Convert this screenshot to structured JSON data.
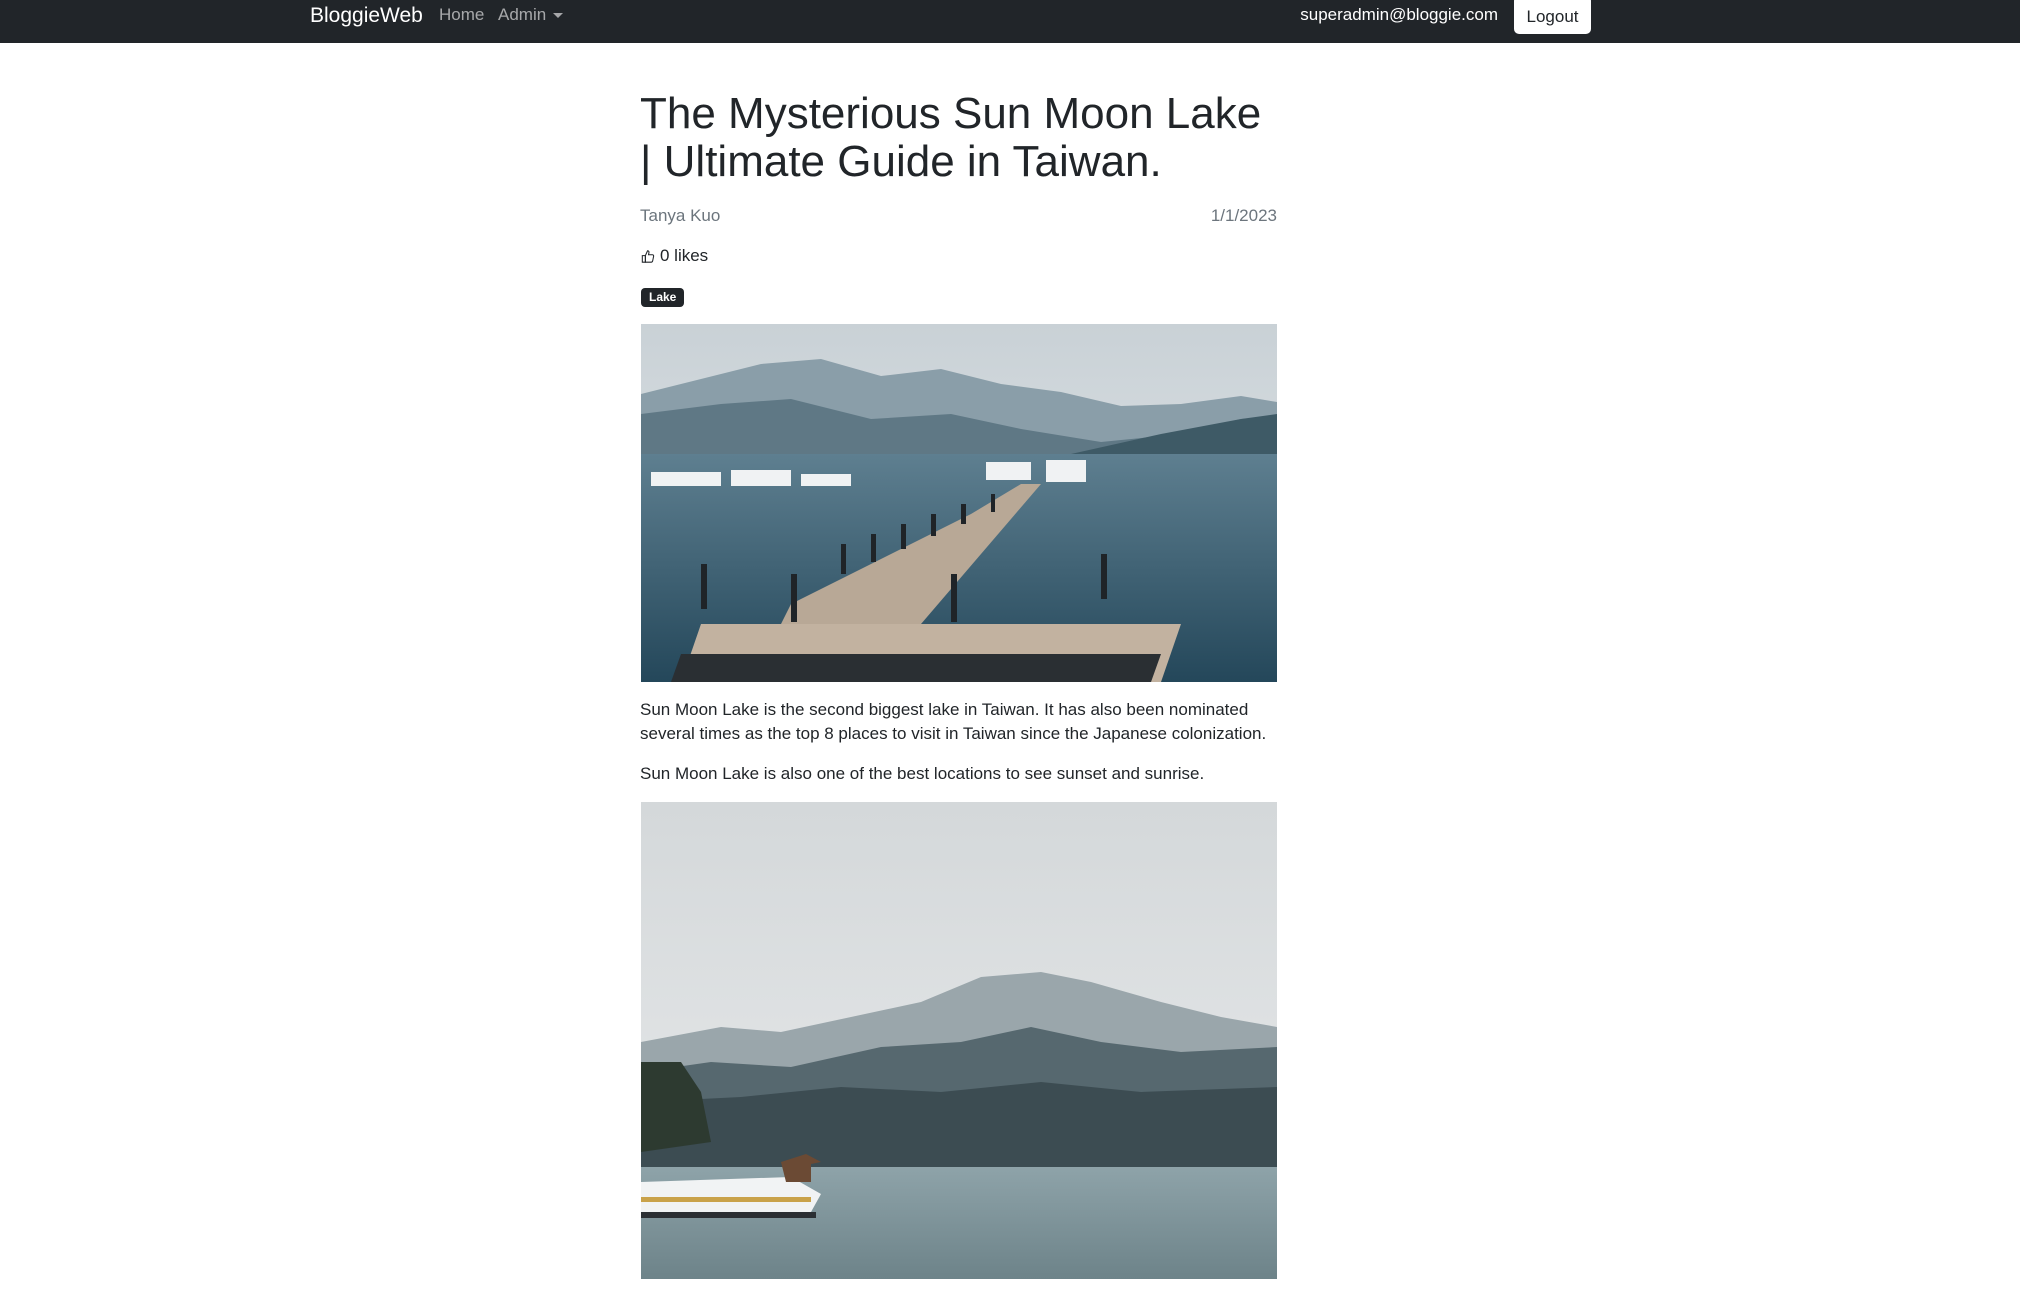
{
  "navbar": {
    "brand": "BloggieWeb",
    "home_label": "Home",
    "admin_label": "Admin",
    "user_email": "superadmin@bloggie.com",
    "logout_label": "Logout"
  },
  "post": {
    "title": "The Mysterious Sun Moon Lake | Ultimate Guide in Taiwan.",
    "author": "Tanya Kuo",
    "date": "1/1/2023",
    "likes_text": "0 likes",
    "like_icon": "thumbs-up-icon",
    "tags": [
      "Lake"
    ],
    "paragraphs": [
      "Sun Moon Lake is the second biggest lake in Taiwan. It has also been nominated several times as the top 8 places to visit in Taiwan since the Japanese colonization.",
      "Sun Moon Lake is also one of the best locations to see sunset and sunrise."
    ],
    "images": [
      {
        "subject": "pier with boats on lake and mountains"
      },
      {
        "subject": "misty mountains over lake with boats"
      }
    ]
  },
  "colors": {
    "navbar_bg": "#212529",
    "tag_bg": "#212529",
    "muted_text": "#6c757d"
  }
}
